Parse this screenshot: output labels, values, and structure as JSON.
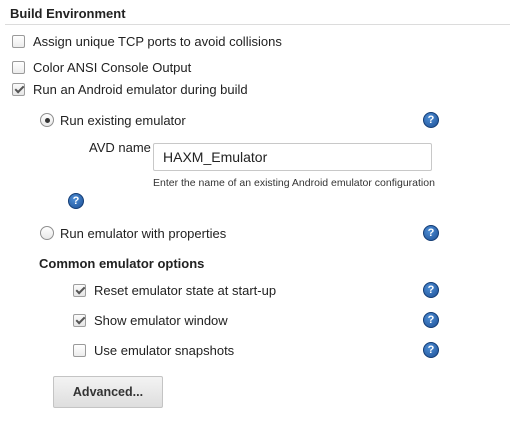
{
  "section": {
    "title": "Build Environment"
  },
  "options": [
    {
      "label": "Assign unique TCP ports to avoid collisions",
      "checked": false
    },
    {
      "label": "Color ANSI Console Output",
      "checked": false
    },
    {
      "label": "Run an Android emulator during build",
      "checked": true
    }
  ],
  "emulator": {
    "existing_label": "Run existing emulator",
    "existing_selected": true,
    "avd_label": "AVD name",
    "avd_value": "HAXM_Emulator",
    "avd_hint": "Enter the name of an existing Android emulator configuration",
    "properties_label": "Run emulator with properties",
    "properties_selected": false
  },
  "common": {
    "title": "Common emulator options",
    "items": [
      {
        "label": "Reset emulator state at start-up",
        "checked": true
      },
      {
        "label": "Show emulator window",
        "checked": true
      },
      {
        "label": "Use emulator snapshots",
        "checked": false
      }
    ]
  },
  "help_glyph": "?",
  "advanced_button": "Advanced...",
  "colors": {
    "help_blue": "#1c4f95",
    "rule": "#dcdcdc"
  }
}
